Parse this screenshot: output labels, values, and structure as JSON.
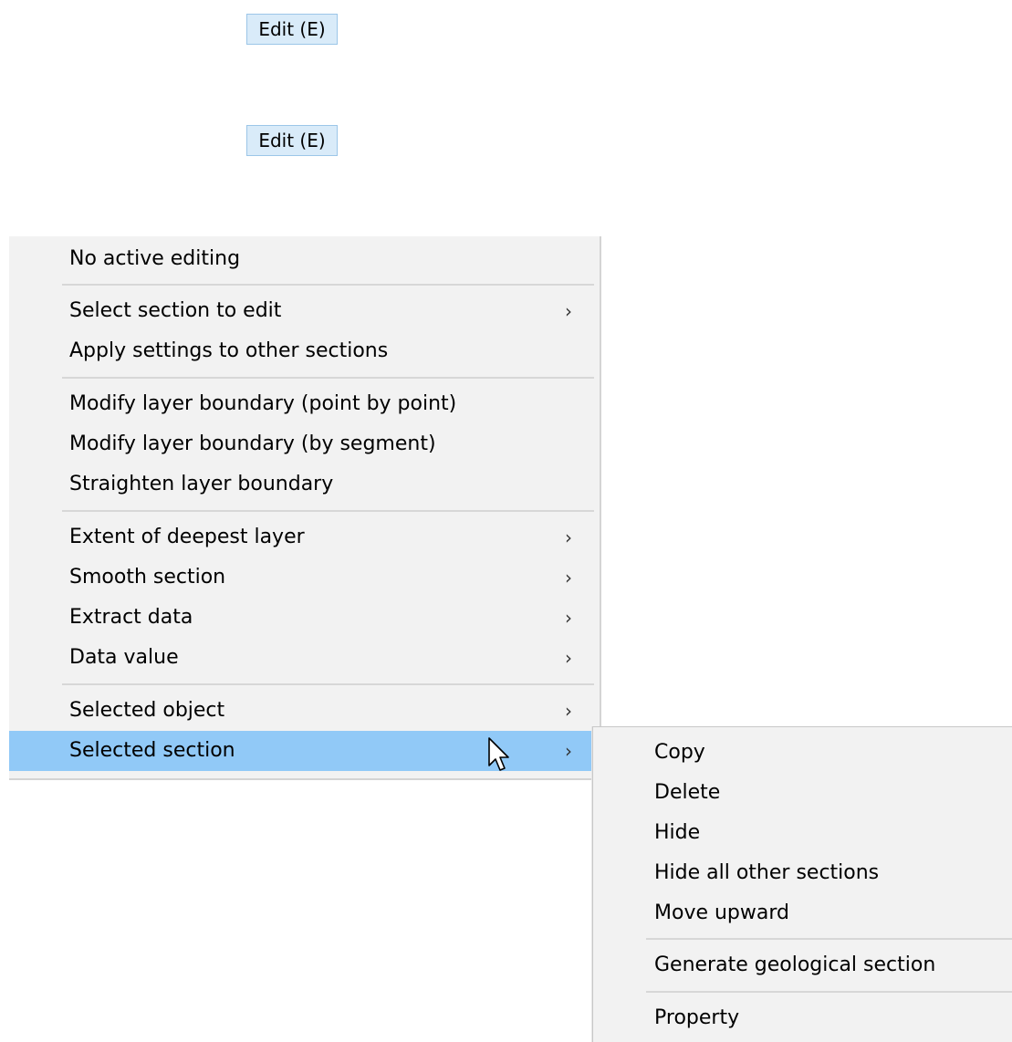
{
  "buttons": {
    "edit_top": "Edit (E)",
    "edit_bottom": "Edit (E)"
  },
  "context_menu": {
    "groups": [
      {
        "items": [
          {
            "label": "No active editing",
            "submenu": false
          }
        ]
      },
      {
        "items": [
          {
            "label": "Select section to edit",
            "submenu": true
          },
          {
            "label": "Apply settings to other sections",
            "submenu": false
          }
        ]
      },
      {
        "items": [
          {
            "label": "Modify layer boundary (point by point)",
            "submenu": false
          },
          {
            "label": "Modify layer boundary (by segment)",
            "submenu": false
          },
          {
            "label": "Straighten layer boundary",
            "submenu": false
          }
        ]
      },
      {
        "items": [
          {
            "label": "Extent of deepest layer",
            "submenu": true
          },
          {
            "label": "Smooth section",
            "submenu": true
          },
          {
            "label": "Extract data",
            "submenu": true
          },
          {
            "label": "Data value",
            "submenu": true
          }
        ]
      },
      {
        "items": [
          {
            "label": "Selected object",
            "submenu": true
          },
          {
            "label": "Selected section",
            "submenu": true,
            "highlighted": true
          }
        ]
      }
    ],
    "submenu_arrow": "›"
  },
  "submenu": {
    "parent": "Selected section",
    "groups": [
      {
        "items": [
          {
            "label": "Copy"
          },
          {
            "label": "Delete"
          },
          {
            "label": "Hide"
          },
          {
            "label": "Hide all other sections"
          },
          {
            "label": "Move upward"
          }
        ]
      },
      {
        "items": [
          {
            "label": "Generate geological section"
          }
        ]
      },
      {
        "items": [
          {
            "label": "Property"
          }
        ]
      }
    ]
  },
  "icons": {
    "cursor": "mouse-pointer-icon",
    "submenu_arrow": "chevron-right-icon"
  },
  "colors": {
    "highlight": "#91c9f7",
    "menu_background": "#f2f2f2",
    "button_background": "#d9ebf9",
    "button_border": "#9cc6e8"
  }
}
